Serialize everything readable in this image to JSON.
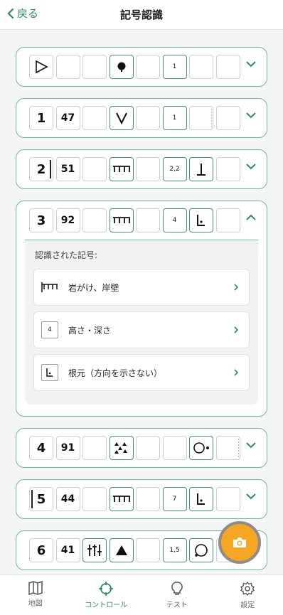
{
  "header": {
    "back_label": "戻る",
    "title": "記号認識"
  },
  "rows": [
    {
      "number": "",
      "code": "",
      "cells": [
        "▷",
        "",
        "",
        "●",
        "",
        "1",
        "",
        ""
      ]
    },
    {
      "number": "1",
      "code": "47",
      "cells": [
        "",
        "V",
        "",
        "1",
        "",
        ""
      ]
    },
    {
      "number": "2",
      "code": "51",
      "cells": [
        "",
        "ㄇㄇ",
        "",
        "2,2",
        "⊥",
        ""
      ]
    },
    {
      "number": "3",
      "code": "92",
      "cells": [
        "",
        "ㄇㄇ",
        "",
        "4",
        "⌞",
        ""
      ]
    },
    {
      "number": "4",
      "code": "91",
      "cells": [
        "",
        "∴",
        "",
        "",
        "○•",
        ""
      ]
    },
    {
      "number": "5",
      "code": "44",
      "cells": [
        "",
        "ㄇㄇ",
        "",
        "7",
        "⌞",
        ""
      ]
    },
    {
      "number": "6",
      "code": "41",
      "cells": [
        "‖",
        "▲",
        "",
        "1,5",
        "○",
        ""
      ]
    }
  ],
  "panel": {
    "title": "認識された記号:",
    "items": [
      {
        "icon": "cliff-icon",
        "label": "岩がけ、岸壁"
      },
      {
        "icon_text": "4",
        "label": "高さ・深さ"
      },
      {
        "icon": "foot-icon",
        "label": "根元（方向を示さない）"
      }
    ]
  },
  "tabs": [
    {
      "label": "地図",
      "icon": "map-icon"
    },
    {
      "label": "コントロール",
      "icon": "control-icon"
    },
    {
      "label": "テスト",
      "icon": "lightbulb-icon"
    },
    {
      "label": "設定",
      "icon": "gear-icon"
    }
  ],
  "colors": {
    "accent": "#2e8b6a",
    "border": "#6fb895",
    "fab": "#f5a623"
  }
}
